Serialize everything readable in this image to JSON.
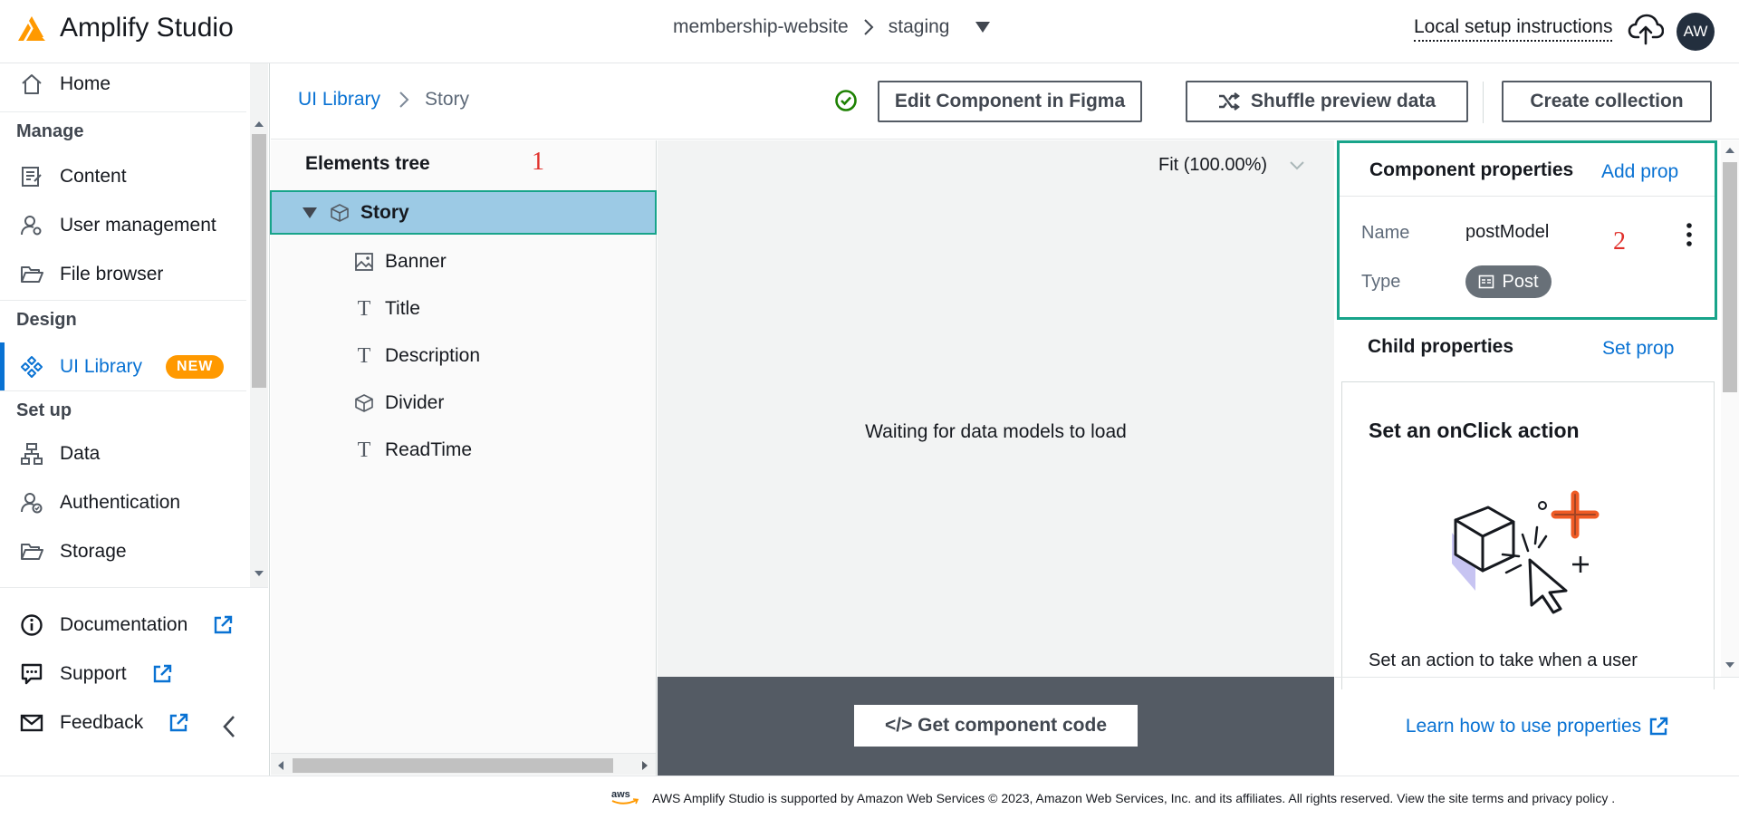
{
  "app": {
    "name": "Amplify Studio"
  },
  "topbar": {
    "app_name": "membership-website",
    "environment": "staging",
    "local_setup": "Local setup instructions",
    "avatar_initials": "AW"
  },
  "sidebar": {
    "home": "Home",
    "sections": {
      "manage": "Manage",
      "design": "Design",
      "setup": "Set up"
    },
    "manage_items": [
      "Content",
      "User management",
      "File browser"
    ],
    "design_items": [
      "UI Library"
    ],
    "new_badge": "NEW",
    "setup_items": [
      "Data",
      "Authentication",
      "Storage"
    ],
    "bottom_items": [
      "Documentation",
      "Support",
      "Feedback"
    ]
  },
  "header": {
    "breadcrumb_root": "UI Library",
    "breadcrumb_current": "Story",
    "edit_figma": "Edit Component in Figma",
    "shuffle": "Shuffle preview data",
    "create_collection": "Create collection"
  },
  "tree": {
    "title": "Elements tree",
    "annotation": "1",
    "root": "Story",
    "children": [
      "Banner",
      "Title",
      "Description",
      "Divider",
      "ReadTime"
    ]
  },
  "canvas": {
    "zoom": "Fit (100.00%)",
    "status": "Waiting for data models to load",
    "get_code": "</> Get component code"
  },
  "props": {
    "title": "Component properties",
    "add_prop": "Add prop",
    "annotation": "2",
    "name_label": "Name",
    "name_value": "postModel",
    "type_label": "Type",
    "type_value": "Post",
    "child_title": "Child properties",
    "set_prop": "Set prop",
    "card_title": "Set an onClick action",
    "card_text": "Set an action to take when a user",
    "learn_link": "Learn how to use properties"
  },
  "footer": {
    "text": "AWS Amplify Studio is supported by Amazon Web Services © 2023, Amazon Web Services, Inc. and its affiliates. All rights reserved. View the site terms and privacy policy ."
  },
  "colors": {
    "accent": "#0972d3",
    "brand_orange": "#ff9900",
    "selection": "#9ccae5",
    "highlight_border": "#18a48a",
    "annotation": "#e0302b"
  }
}
